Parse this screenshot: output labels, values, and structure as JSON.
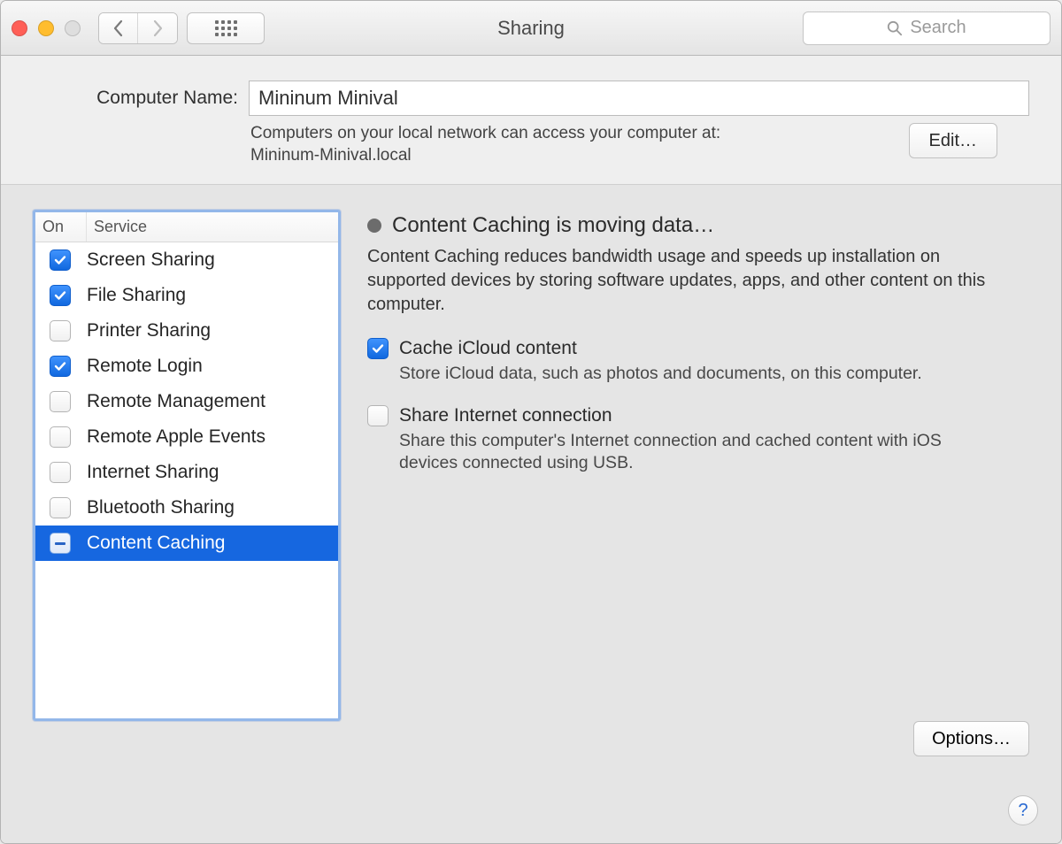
{
  "window": {
    "title": "Sharing",
    "search_placeholder": "Search"
  },
  "upper": {
    "label": "Computer Name:",
    "value": "Mininum Minival",
    "info_line1": "Computers on your local network can access your computer at:",
    "info_line2": "Mininum-Minival.local",
    "edit_label": "Edit…"
  },
  "services": {
    "col_on": "On",
    "col_service": "Service",
    "items": [
      {
        "label": "Screen Sharing",
        "state": "on"
      },
      {
        "label": "File Sharing",
        "state": "on"
      },
      {
        "label": "Printer Sharing",
        "state": "off"
      },
      {
        "label": "Remote Login",
        "state": "on"
      },
      {
        "label": "Remote Management",
        "state": "off"
      },
      {
        "label": "Remote Apple Events",
        "state": "off"
      },
      {
        "label": "Internet Sharing",
        "state": "off"
      },
      {
        "label": "Bluetooth Sharing",
        "state": "off"
      },
      {
        "label": "Content Caching",
        "state": "mixed",
        "selected": true
      }
    ]
  },
  "details": {
    "status": "Content Caching is moving data…",
    "desc": "Content Caching reduces bandwidth usage and speeds up installation on supported devices by storing software updates, apps, and other content on this computer.",
    "opt1_label": "Cache iCloud content",
    "opt1_desc": "Store iCloud data, such as photos and documents, on this computer.",
    "opt2_label": "Share Internet connection",
    "opt2_desc": "Share this computer's Internet connection and cached content with iOS devices connected using USB.",
    "options_button": "Options…"
  },
  "help_label": "?"
}
